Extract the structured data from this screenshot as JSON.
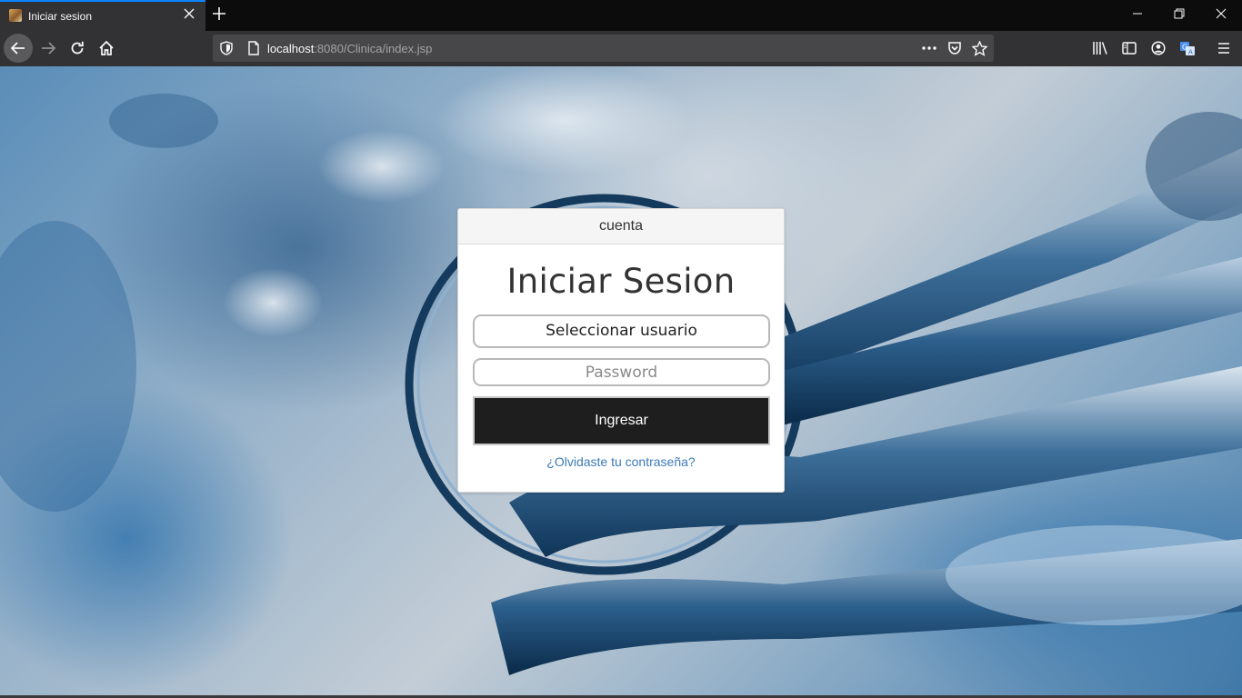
{
  "browser": {
    "tab": {
      "title": "Iniciar sesion"
    },
    "url": {
      "host": "localhost",
      "path": ":8080/Clinica/index.jsp"
    },
    "icons": {
      "favicon": "clinic-favicon-icon",
      "close_tab": "close-icon",
      "new_tab": "plus-icon",
      "minimize": "minimize-icon",
      "restore": "restore-icon",
      "close_window": "close-icon",
      "back": "arrow-left-icon",
      "forward": "arrow-right-icon",
      "reload": "reload-icon",
      "home": "home-icon",
      "tracking_protection": "shield-icon",
      "page_info": "page-icon",
      "page_actions": "more-horizontal-icon",
      "pocket": "pocket-icon",
      "bookmark": "star-icon",
      "library": "library-icon",
      "sidebar": "sidebar-icon",
      "account": "account-icon",
      "translate": "translate-icon",
      "menu": "hamburger-menu-icon"
    },
    "colors": {
      "accent": "#0a84ff",
      "toolbar": "#323234",
      "tabstrip": "#0c0c0d",
      "urlbar": "#474749"
    }
  },
  "login": {
    "header": "cuenta",
    "title": "Iniciar Sesion",
    "select_user": "Seleccionar usuario",
    "password_placeholder": "Password",
    "submit": "Ingresar",
    "forgot_link": "¿Olvidaste tu contraseña?",
    "colors": {
      "button": "#1e1e1e",
      "link": "#3b7ab8"
    }
  }
}
